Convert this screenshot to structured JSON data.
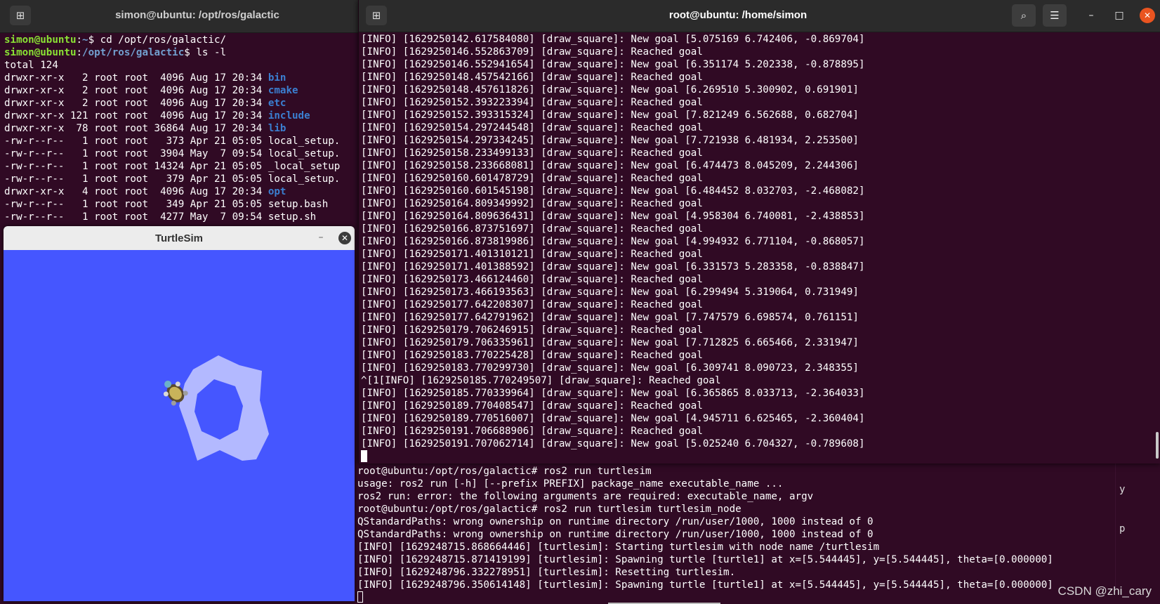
{
  "left_terminal": {
    "title": "simon@ubuntu: /opt/ros/galactic",
    "newtab_icon": "⊞",
    "lines": [
      {
        "user": "simon@ubuntu",
        "sep": ":",
        "path": "~",
        "cmd": "$ cd /opt/ros/galactic/"
      },
      {
        "user": "simon@ubuntu",
        "sep": ":",
        "path": "/opt/ros/galactic",
        "cmd": "$ ls -l"
      }
    ],
    "total": "total 124",
    "listing": [
      {
        "meta": "drwxr-xr-x   2 root root  4096 Aug 17 20:34 ",
        "name": "bin",
        "dir": true
      },
      {
        "meta": "drwxr-xr-x   2 root root  4096 Aug 17 20:34 ",
        "name": "cmake",
        "dir": true
      },
      {
        "meta": "drwxr-xr-x   2 root root  4096 Aug 17 20:34 ",
        "name": "etc",
        "dir": true
      },
      {
        "meta": "drwxr-xr-x 121 root root  4096 Aug 17 20:34 ",
        "name": "include",
        "dir": true
      },
      {
        "meta": "drwxr-xr-x  78 root root 36864 Aug 17 20:34 ",
        "name": "lib",
        "dir": true
      },
      {
        "meta": "-rw-r--r--   1 root root   373 Apr 21 05:05 ",
        "name": "local_setup.",
        "dir": false
      },
      {
        "meta": "-rw-r--r--   1 root root  3904 May  7 09:54 ",
        "name": "local_setup.",
        "dir": false
      },
      {
        "meta": "-rw-r--r--   1 root root 14324 Apr 21 05:05 ",
        "name": "_local_setup",
        "dir": false
      },
      {
        "meta": "-rw-r--r--   1 root root   379 Apr 21 05:05 ",
        "name": "local_setup.",
        "dir": false
      },
      {
        "meta": "drwxr-xr-x   4 root root  4096 Aug 17 20:34 ",
        "name": "opt",
        "dir": true
      },
      {
        "meta": "-rw-r--r--   1 root root   349 Apr 21 05:05 ",
        "name": "setup.bash",
        "dir": false
      },
      {
        "meta": "-rw-r--r--   1 root root  4277 May  7 09:54 ",
        "name": "setup.sh",
        "dir": false
      }
    ]
  },
  "turtlesim": {
    "title": "TurtleSim",
    "minimize_label": "–",
    "close_label": "✕",
    "background": "#4556ff",
    "trail_color": "#b3b9ff"
  },
  "right_terminal": {
    "title": "root@ubuntu: /home/simon",
    "newtab_icon": "⊞",
    "search_icon": "⌕",
    "menu_icon": "☰",
    "minimize_icon": "–",
    "maximize_icon": "□",
    "close_icon": "✕",
    "lines": [
      "[INFO] [1629250142.617584080] [draw_square]: New goal [5.075169 6.742406, -0.869704]",
      "[INFO] [1629250146.552863709] [draw_square]: Reached goal",
      "[INFO] [1629250146.552941654] [draw_square]: New goal [6.351174 5.202338, -0.878895]",
      "[INFO] [1629250148.457542166] [draw_square]: Reached goal",
      "[INFO] [1629250148.457611826] [draw_square]: New goal [6.269510 5.300902, 0.691901]",
      "[INFO] [1629250152.393223394] [draw_square]: Reached goal",
      "[INFO] [1629250152.393315324] [draw_square]: New goal [7.821249 6.562688, 0.682704]",
      "[INFO] [1629250154.297244548] [draw_square]: Reached goal",
      "[INFO] [1629250154.297334245] [draw_square]: New goal [7.721938 6.481934, 2.253500]",
      "[INFO] [1629250158.233499133] [draw_square]: Reached goal",
      "[INFO] [1629250158.233668081] [draw_square]: New goal [6.474473 8.045209, 2.244306]",
      "[INFO] [1629250160.601478729] [draw_square]: Reached goal",
      "[INFO] [1629250160.601545198] [draw_square]: New goal [6.484452 8.032703, -2.468082]",
      "[INFO] [1629250164.809349992] [draw_square]: Reached goal",
      "[INFO] [1629250164.809636431] [draw_square]: New goal [4.958304 6.740081, -2.438853]",
      "[INFO] [1629250166.873751697] [draw_square]: Reached goal",
      "[INFO] [1629250166.873819986] [draw_square]: New goal [4.994932 6.771104, -0.868057]",
      "[INFO] [1629250171.401310121] [draw_square]: Reached goal",
      "[INFO] [1629250171.401388592] [draw_square]: New goal [6.331573 5.283358, -0.838847]",
      "[INFO] [1629250173.466124460] [draw_square]: Reached goal",
      "[INFO] [1629250173.466193563] [draw_square]: New goal [6.299494 5.319064, 0.731949]",
      "[INFO] [1629250177.642208307] [draw_square]: Reached goal",
      "[INFO] [1629250177.642791962] [draw_square]: New goal [7.747579 6.698574, 0.761151]",
      "[INFO] [1629250179.706246915] [draw_square]: Reached goal",
      "[INFO] [1629250179.706335961] [draw_square]: New goal [7.712825 6.665466, 2.331947]",
      "[INFO] [1629250183.770225428] [draw_square]: Reached goal",
      "[INFO] [1629250183.770299730] [draw_square]: New goal [6.309741 8.090723, 2.348355]",
      "^[1[INFO] [1629250185.770249507] [draw_square]: Reached goal",
      "[INFO] [1629250185.770339964] [draw_square]: New goal [6.365865 8.033713, -2.364033]",
      "[INFO] [1629250189.770408547] [draw_square]: Reached goal",
      "[INFO] [1629250189.770516007] [draw_square]: New goal [4.945711 6.625465, -2.360404]",
      "[INFO] [1629250191.706688906] [draw_square]: Reached goal",
      "[INFO] [1629250191.707062714] [draw_square]: New goal [5.025240 6.704327, -0.789608]"
    ]
  },
  "bottom_terminal": {
    "lines": [
      "root@ubuntu:/opt/ros/galactic# ros2 run turtlesim",
      "usage: ros2 run [-h] [--prefix PREFIX] package_name executable_name ...",
      "ros2 run: error: the following arguments are required: executable_name, argv",
      "root@ubuntu:/opt/ros/galactic# ros2 run turtlesim turtlesim_node",
      "QStandardPaths: wrong ownership on runtime directory /run/user/1000, 1000 instead of 0",
      "QStandardPaths: wrong ownership on runtime directory /run/user/1000, 1000 instead of 0",
      "[INFO] [1629248715.868664446] [turtlesim]: Starting turtlesim with node name /turtlesim",
      "[INFO] [1629248715.871419199] [turtlesim]: Spawning turtle [turtle1] at x=[5.544445], y=[5.544445], theta=[0.000000]",
      "[INFO] [1629248796.332278951] [turtlesim]: Resetting turtlesim.",
      "[INFO] [1629248796.350614148] [turtlesim]: Spawning turtle [turtle1] at x=[5.544445], y=[5.544445], theta=[0.000000]"
    ],
    "behind_char_1": "y",
    "behind_char_2": "p"
  },
  "watermark": "CSDN @zhi_cary"
}
